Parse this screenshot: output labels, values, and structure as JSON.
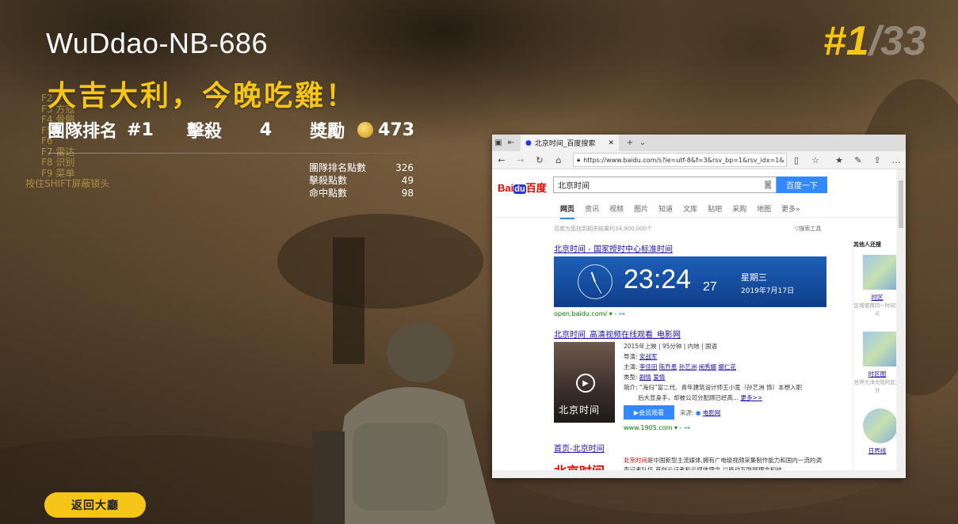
{
  "hud": {
    "player_name": "WuDdao-NB-686",
    "win_message": "大吉大利，今晚吃雞！",
    "rank_me": "#1",
    "rank_total": "/33",
    "team_rank_label": "團隊排名",
    "team_rank_value": "#1",
    "kills_label": "擊殺",
    "kills_value": "4",
    "reward_label": "獎勵",
    "reward_value": "473",
    "breakdown": [
      {
        "label": "團隊排名點數",
        "value": "326"
      },
      {
        "label": "擊殺點數",
        "value": "49"
      },
      {
        "label": "命中點數",
        "value": "98"
      }
    ],
    "back_button": "返回大廳",
    "colors": {
      "accent": "#f5c518"
    }
  },
  "bg_menu": {
    "items": [
      "F2",
      "F3 方寇",
      "F4 骨骼",
      "F5",
      "F6",
      "F7 雷达",
      "F8 识别",
      "F9 菜单"
    ],
    "hint": "按住SHIFT屏蔽锁头"
  },
  "browser": {
    "tab_title": "北京时间_百度搜索",
    "url": "https://www.baidu.com/s?ie=utf-8&f=3&rsv_bp=1&rsv_idx=1&",
    "logo_text": "Bai",
    "logo_paw": "du",
    "logo_cn": "百度",
    "search_value": "北京时间",
    "search_button": "百度一下",
    "nav_tabs": [
      "网页",
      "资讯",
      "视频",
      "图片",
      "知道",
      "文库",
      "贴吧",
      "采购",
      "地图",
      "更多»"
    ],
    "result_count": "百度为您找到相关结果约34,900,000个",
    "search_tools": "搜索工具",
    "result1_title": "北京时间 - 国家授时中心标准时间",
    "clock_time": "23:24",
    "clock_seconds": "27",
    "clock_weekday": "星期三",
    "clock_date": "2019年7月17日",
    "result1_site": "open.baidu.com/",
    "result2_title": "北京时间_高清视频在线观看_电影网",
    "movie_meta": "2015年上映 | 95分钟 | 内地 | 国语",
    "director_label": "导演:",
    "director": "安战军",
    "cast_label": "主演:",
    "cast": [
      "李佳田",
      "陈乔恩",
      "孙艺洲",
      "闹秀娜",
      "娜仁花"
    ],
    "genre_label": "类型:",
    "genres": [
      "剧情",
      "爱情"
    ],
    "synopsis": "简介: “海归”富二代、青年建筑设计师王小宽（孙艺洲 饰）本想入职",
    "synopsis2": "后大显身手，却被公司分配顾已经高...",
    "more": "更多>>",
    "poster_caption": "北京时间",
    "watch_button": "会员观看",
    "source_label": "来源:",
    "source": "电影网",
    "result2_site": "www.1905.com",
    "result3_title": "首页-北京时间",
    "result3_logo": "北京时间",
    "result3_desc_hl": "北京时间",
    "result3_desc": "是中国新型主流媒体,拥有广电级视频采集制作能力和国内一流的调查记者队伍,首创云记者和云媒体理念,以移动互联网理念和技",
    "side_header": "其他人还搜",
    "side_items": [
      {
        "label": "时区",
        "sub": "区域使用同一时间定义"
      },
      {
        "label": "时区图",
        "sub": "世界大洋大陆时区划分"
      },
      {
        "label": "日界线",
        "sub": ""
      }
    ]
  }
}
